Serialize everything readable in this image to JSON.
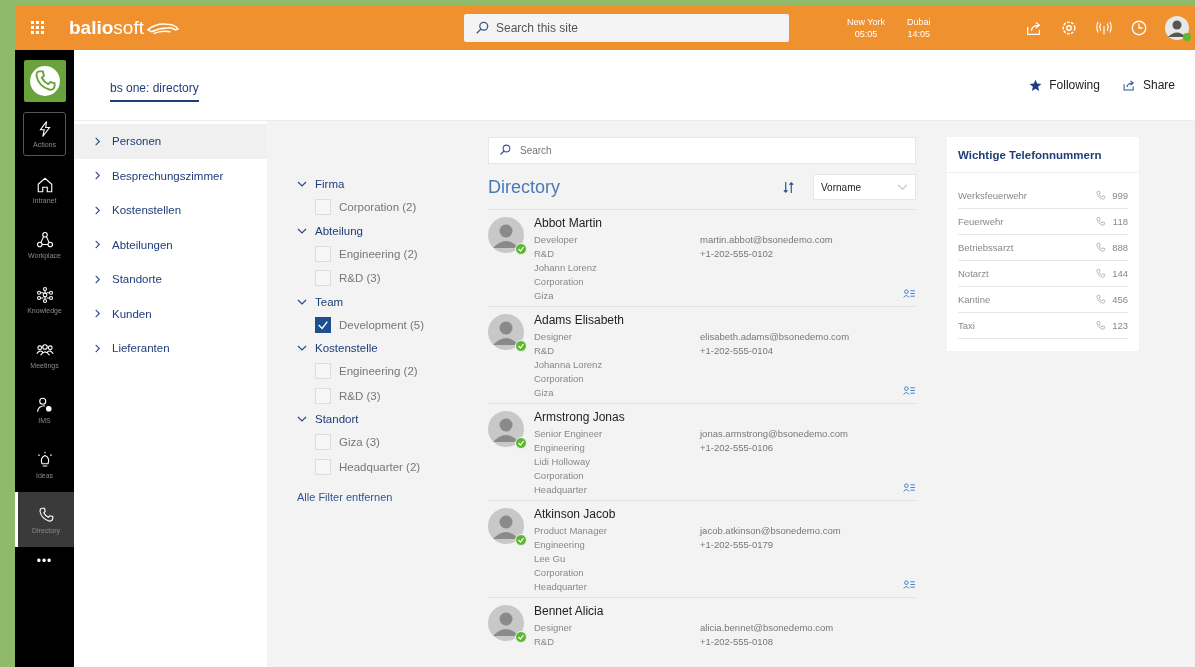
{
  "topbar": {
    "logo": "**balio**soft",
    "search": {
      "placeholder": "Search this site"
    },
    "clocks": [
      {
        "city": "New York",
        "time": "05:05"
      },
      {
        "city": "Dubai",
        "time": "14:05"
      }
    ],
    "user": {
      "online": true
    }
  },
  "rail": {
    "items": [
      {
        "label": "Actions",
        "selected": false,
        "focused": true
      },
      {
        "label": "Intranet",
        "selected": false,
        "focused": false
      },
      {
        "label": "Workplace",
        "selected": false,
        "focused": false
      },
      {
        "label": "Knowledge",
        "selected": false,
        "focused": false
      },
      {
        "label": "Meetings",
        "selected": false,
        "focused": false
      },
      {
        "label": "IMS",
        "selected": false,
        "focused": false
      },
      {
        "label": "Ideas",
        "selected": false,
        "focused": false
      },
      {
        "label": "Directory",
        "selected": true,
        "focused": false
      }
    ],
    "more": "•••"
  },
  "header": {
    "tab": "bs one: directory",
    "actions": [
      {
        "label": "Following"
      },
      {
        "label": "Share"
      }
    ]
  },
  "nav": [
    {
      "label": "Personen",
      "selected": true
    },
    {
      "label": "Besprechungszimmer",
      "selected": false
    },
    {
      "label": "Kostenstellen",
      "selected": false
    },
    {
      "label": "Abteilungen",
      "selected": false
    },
    {
      "label": "Standorte",
      "selected": false
    },
    {
      "label": "Kunden",
      "selected": false
    },
    {
      "label": "Lieferanten",
      "selected": false
    }
  ],
  "filters": {
    "groups": [
      {
        "title": "Firma",
        "expanded": true,
        "options": [
          {
            "label": "Corporation (2)",
            "checked": false
          }
        ]
      },
      {
        "title": "Abteilung",
        "expanded": true,
        "options": [
          {
            "label": "Engineering (2)",
            "checked": false
          },
          {
            "label": "R&D (3)",
            "checked": false
          }
        ]
      },
      {
        "title": "Team",
        "expanded": true,
        "options": [
          {
            "label": "Development (5)",
            "checked": true
          }
        ]
      },
      {
        "title": "Kostenstelle",
        "expanded": true,
        "options": [
          {
            "label": "Engineering (2)",
            "checked": false
          },
          {
            "label": "R&D (3)",
            "checked": false
          }
        ]
      },
      {
        "title": "Standort",
        "expanded": true,
        "options": [
          {
            "label": "Giza (3)",
            "checked": false
          },
          {
            "label": "Headquarter (2)",
            "checked": false
          }
        ]
      }
    ],
    "clear": "Alle Filter entfernen"
  },
  "directory": {
    "search": {
      "placeholder": "Search"
    },
    "title": "Directory",
    "sort": {
      "value": "Vorname"
    },
    "people": [
      {
        "name": "Abbot Martin",
        "online": true,
        "details": [
          "Developer",
          "R&D",
          "Johann Lorenz",
          "Corporation",
          "Giza"
        ],
        "email": "martin.abbot@bsonedemo.com",
        "phone": "+1-202-555-0102"
      },
      {
        "name": "Adams Elisabeth",
        "online": true,
        "details": [
          "Designer",
          "R&D",
          "Johanna Lorenz",
          "Corporation",
          "Giza"
        ],
        "email": "elisabeth.adams@bsonedemo.com",
        "phone": "+1-202-555-0104"
      },
      {
        "name": "Armstrong Jonas",
        "online": true,
        "details": [
          "Senior Engineer",
          "Engineering",
          "Lidi Holloway",
          "Corporation",
          "Headquarter"
        ],
        "email": "jonas.armstrong@bsonedemo.com",
        "phone": "+1-202-555-0106"
      },
      {
        "name": "Atkinson Jacob",
        "online": true,
        "details": [
          "Product Manager",
          "Engineering",
          "Lee Gu",
          "Corporation",
          "Headquarter"
        ],
        "email": "jacob.atkinson@bsonedemo.com",
        "phone": "+1-202-555-0179"
      },
      {
        "name": "Bennet Alicia",
        "online": true,
        "details": [
          "Designer",
          "R&D"
        ],
        "email": "alicia.bennet@bsonedemo.com",
        "phone": "+1-202-555-0108"
      }
    ]
  },
  "phones": {
    "title": "Wichtige Telefonnummern",
    "entries": [
      {
        "name": "Werksfeuerwehr",
        "number": "999"
      },
      {
        "name": "Feuerwehr",
        "number": "118"
      },
      {
        "name": "Betriebssarzt",
        "number": "888"
      },
      {
        "name": "Notarzt",
        "number": "144"
      },
      {
        "name": "Kantine",
        "number": "456"
      },
      {
        "name": "Taxi",
        "number": "123"
      }
    ]
  }
}
